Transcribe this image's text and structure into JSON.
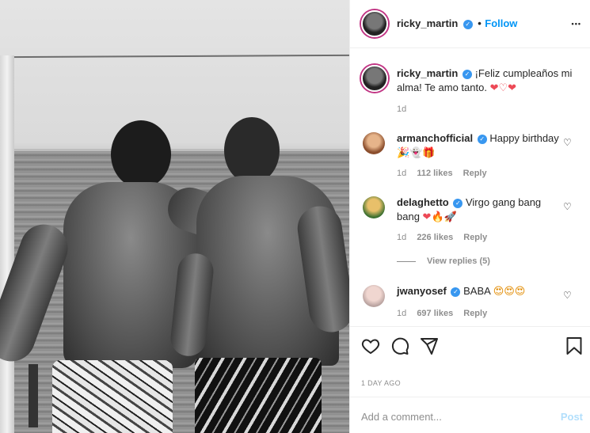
{
  "post": {
    "username": "ricky_martin",
    "follow_separator": "•",
    "follow_label": "Follow",
    "more_label": "•••"
  },
  "caption": {
    "username": "ricky_martin",
    "text": "¡Feliz cumpleaños mi alma! Te amo tanto.",
    "emojis": "❤♡❤",
    "time": "1d"
  },
  "comments": [
    {
      "username": "armanchofficial",
      "text": "Happy birthday",
      "emojis": "🎉👻🎁",
      "time": "1d",
      "likes": "112 likes",
      "reply_label": "Reply"
    },
    {
      "username": "delaghetto",
      "text": "Virgo gang bang bang",
      "emojis": "❤🔥🚀",
      "time": "1d",
      "likes": "226 likes",
      "reply_label": "Reply",
      "view_replies": "View replies (5)"
    },
    {
      "username": "jwanyosef",
      "text": "BABA",
      "emojis": "😍😍😍",
      "time": "1d",
      "likes": "697 likes",
      "reply_label": "Reply"
    }
  ],
  "footer": {
    "date": "1 DAY AGO",
    "comment_placeholder": "Add a comment...",
    "post_label": "Post"
  },
  "icons": {
    "like": "heart-icon",
    "comment": "comment-icon",
    "share": "share-icon",
    "save": "bookmark-icon",
    "verified": "verified-badge-icon"
  },
  "colors": {
    "accent": "#0095f6",
    "verified": "#3897f0",
    "muted": "#8e8e8e",
    "heart_red": "#ed4956"
  }
}
